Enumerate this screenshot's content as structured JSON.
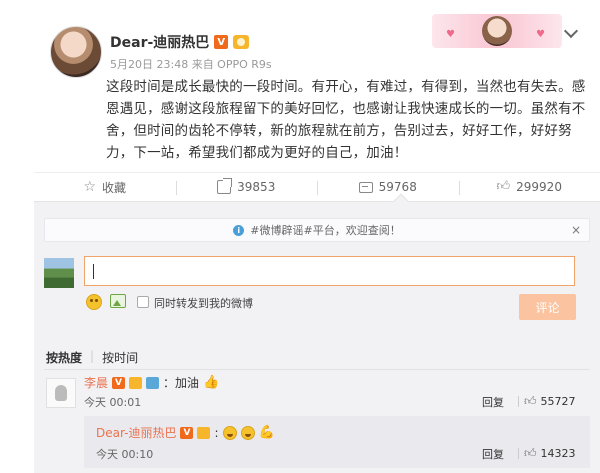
{
  "post": {
    "author": "Dear-迪丽热巴",
    "badge_v": "V",
    "meta": "5月20日 23:48 来自 OPPO R9s",
    "content": "这段时间是成长最快的一段时间。有开心，有难过，有得到，当然也有失去。感恩遇见，感谢这段旅程留下的美好回忆，也感谢让我快速成长的一切。虽然有不舍，但时间的齿轮不停转，新的旅程就在前方，告别过去，好好工作，好好努力，下一站，希望我们都成为更好的自己，加油！"
  },
  "actions": {
    "favorite_label": "收藏",
    "repost_count": "39853",
    "comment_count": "59768",
    "like_count": "299920"
  },
  "comment_box": {
    "notice": "#微博辟谣#平台，欢迎查阅！",
    "notice_close": "×",
    "repost_label": "同时转发到我的微博",
    "submit_label": "评论"
  },
  "sort": {
    "hot": "按热度",
    "time": "按时间"
  },
  "comments": [
    {
      "name": "李晨",
      "text": "：加油",
      "time": "今天 00:01",
      "reply_label": "回复",
      "likes": "55727",
      "replies": [
        {
          "name": "Dear-迪丽热巴",
          "time": "今天 00:10",
          "reply_label": "回复",
          "likes": "14323"
        }
      ]
    }
  ],
  "colors": {
    "accent": "#eb7350",
    "verified": "#f06a1c",
    "submit_disabled": "#fbc3a0"
  }
}
